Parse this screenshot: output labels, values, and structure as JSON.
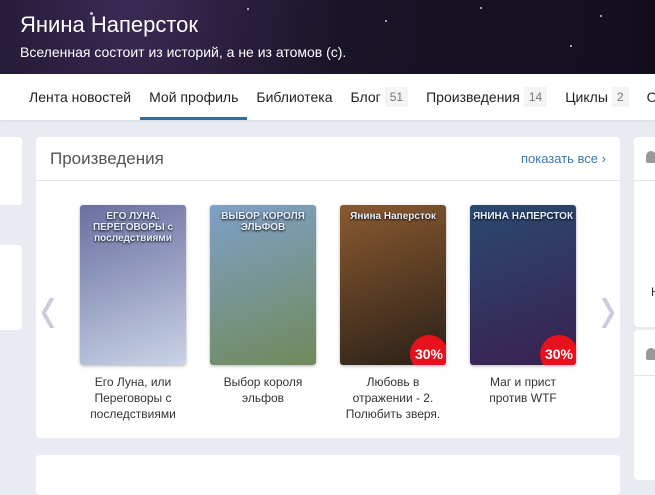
{
  "header": {
    "title": "Янина Наперсток",
    "subtitle": "Вселенная состоит из историй, а не из атомов (с)."
  },
  "nav": [
    {
      "label": "Лента новостей"
    },
    {
      "label": "Мой профиль",
      "active": true
    },
    {
      "label": "Библиотека"
    },
    {
      "label": "Блог",
      "count": "51"
    },
    {
      "label": "Произведения",
      "count": "14"
    },
    {
      "label": "Циклы",
      "count": "2"
    },
    {
      "label": "Ос"
    }
  ],
  "works": {
    "title": "Произведения",
    "show_all": "показать все",
    "chevron": "›",
    "books": [
      {
        "title": "Его Луна, или Переговоры с последствиями",
        "cover_text": "ЕГО ЛУНА. ПЕРЕГОВОРЫ с последствиями",
        "colors": [
          "#6a6fa0",
          "#c9d3e6"
        ]
      },
      {
        "title": "Выбор короля эльфов",
        "cover_text": "ВЫБОР КОРОЛЯ ЭЛЬФОВ",
        "colors": [
          "#7fa0c8",
          "#6f8a5a"
        ]
      },
      {
        "title": "Любовь в отражении - 2. Полюбить зверя.",
        "cover_text": "Янина Наперсток",
        "badge": "30%",
        "colors": [
          "#8a5a30",
          "#2a2018"
        ]
      },
      {
        "title": "Маг и прист против WTF",
        "cover_text": "ЯНИНА НАПЕРСТОК",
        "badge": "30%",
        "colors": [
          "#2a4a70",
          "#3a2050"
        ]
      }
    ]
  },
  "right": {
    "letter": "Н"
  }
}
